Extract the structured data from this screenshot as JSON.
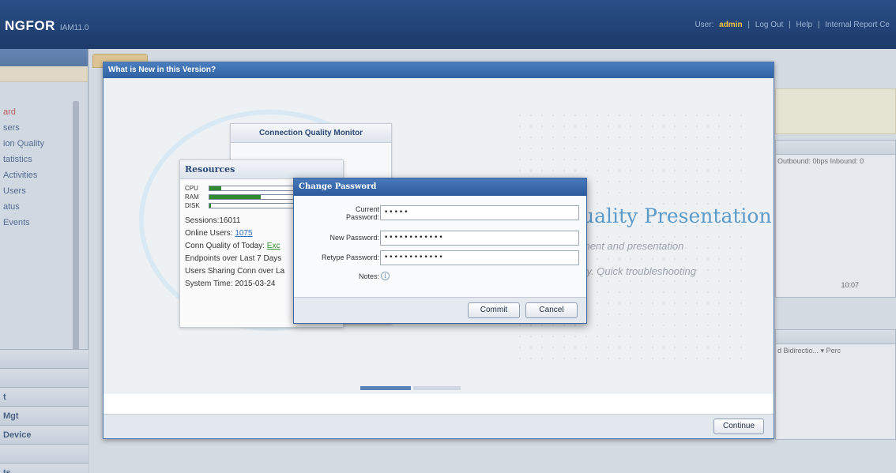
{
  "app": {
    "brand": "NGFOR",
    "version": "IAM11.0"
  },
  "topbar": {
    "user_label": "User:",
    "user_name": "admin",
    "links": [
      "Log Out",
      "Help",
      "Internal Report Ce"
    ]
  },
  "sidebar": {
    "items": [
      "ard",
      "sers",
      "ion Quality",
      "tatistics",
      "Activities",
      "Users",
      "atus",
      "Events"
    ],
    "nav": [
      "",
      "",
      "t",
      "Mgt",
      "Device",
      "",
      "ts"
    ]
  },
  "background": {
    "right_panel_columns": "Outbound: 0bps  Inbound: 0",
    "right_panel_time": "10:07",
    "right_panel2_columns": "d   Bidirectio...  ▾  Perc"
  },
  "whats_new": {
    "title": "What is New in this Version?",
    "cqm_title": "Connection Quality Monitor",
    "resources_title": "Resources",
    "resource_bars": [
      {
        "label": "CPU",
        "level": 0.14
      },
      {
        "label": "RAM",
        "level": 0.6
      },
      {
        "label": "DISK",
        "level": 0.02
      }
    ],
    "lines": {
      "sessions": "Sessions:16011",
      "online_users_label": "Online Users:",
      "online_users_value": "1075",
      "conn_quality_label": "Conn Quality of Today:",
      "conn_quality_value": "Exc",
      "endpoints": "Endpoints over Last 7 Days",
      "sharing": "Users Sharing Conn over La",
      "system_time": "System Time: 2015-03-24"
    },
    "hero": "uality Presentation",
    "sub1": "ment and presentation",
    "sub2": "tly. Quick troubleshooting",
    "continue_label": "Continue"
  },
  "change_password": {
    "title": "Change Password",
    "current_label_1": "Current",
    "current_label_2": "Password:",
    "current_value": "•••••",
    "new_label": "New Password:",
    "new_value": "••••••••••••",
    "retype_label": "Retype Password:",
    "retype_value": "••••••••••••",
    "notes_label": "Notes:",
    "commit_label": "Commit",
    "cancel_label": "Cancel"
  },
  "colors": {
    "titlebar": "#2f62a3",
    "topbar": "#1c3a6a",
    "accent": "#5b9ac9",
    "user_name": "#f4c542"
  },
  "icons": [
    "info-icon"
  ]
}
